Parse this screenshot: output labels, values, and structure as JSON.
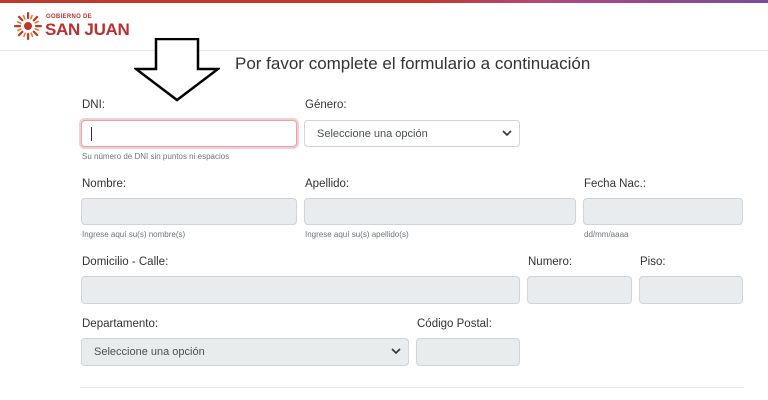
{
  "header": {
    "logo_top": "GOBIERNO DE",
    "logo_main": "SAN JUAN",
    "accent_color": "#b8312f"
  },
  "page": {
    "title": "Por favor complete el formulario a continuación"
  },
  "form": {
    "dni": {
      "label": "DNI:",
      "value": "",
      "help": "Su número de DNI sin puntos ni espacios"
    },
    "genero": {
      "label": "Género:",
      "selected": "Seleccione una opción"
    },
    "nombre": {
      "label": "Nombre:",
      "help": "Ingrese aquí su(s) nombre(s)"
    },
    "apellido": {
      "label": "Apellido:",
      "help": "Ingrese aquí su(s) apellido(s)"
    },
    "fecha_nac": {
      "label": "Fecha Nac.:",
      "help": "dd/mm/aaaa"
    },
    "domicilio": {
      "label": "Domicilio - Calle:"
    },
    "numero": {
      "label": "Numero:"
    },
    "piso": {
      "label": "Piso:"
    },
    "departamento": {
      "label": "Departamento:",
      "selected": "Seleccione una opción"
    },
    "codigo_postal": {
      "label": "Código Postal:"
    }
  },
  "icons": {
    "arrow": "down-arrow-outline-icon",
    "chevron": "chevron-down-icon"
  }
}
